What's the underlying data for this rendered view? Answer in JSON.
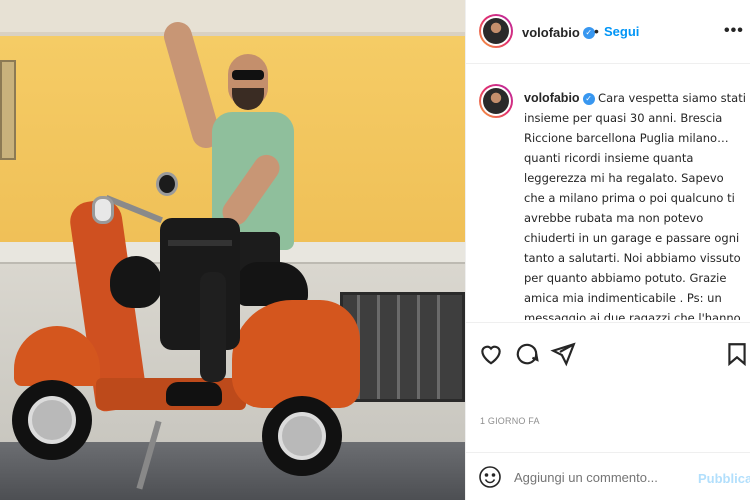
{
  "post": {
    "username": "volofabio",
    "verified_glyph": "✓",
    "dot": "•",
    "follow_label": "Segui",
    "more_label": "•••",
    "caption": "Cara vespetta siamo stati insieme per quasi 30 anni. Brescia Riccione barcellona Puglia milano… quanti ricordi insieme quanta leggerezza mi ha regalato. Sapevo che a milano prima o poi qualcuno ti avrebbe rubata ma non potevo chiuderti in un garage e passare ogni tanto a salutarti. Noi abbiamo vissuto per quanto abbiamo potuto. Grazie amica mia indimenticabile . Ps: un messaggio ai due ragazzi che l'hanno",
    "date_label": "1 GIORNO FA",
    "comment_placeholder": "Aggiungi un commento...",
    "publish_label": "Pubblica"
  },
  "icons": {
    "like": "heart-icon",
    "comment": "comment-icon",
    "share": "send-icon",
    "save": "bookmark-icon",
    "emoji": "emoji-icon",
    "more": "more-icon",
    "verified": "verified-badge-icon"
  },
  "colors": {
    "accent": "#0095f6",
    "publish_disabled": "#b2dffc",
    "verified": "#3897f0",
    "muted": "#8e8e8e"
  }
}
